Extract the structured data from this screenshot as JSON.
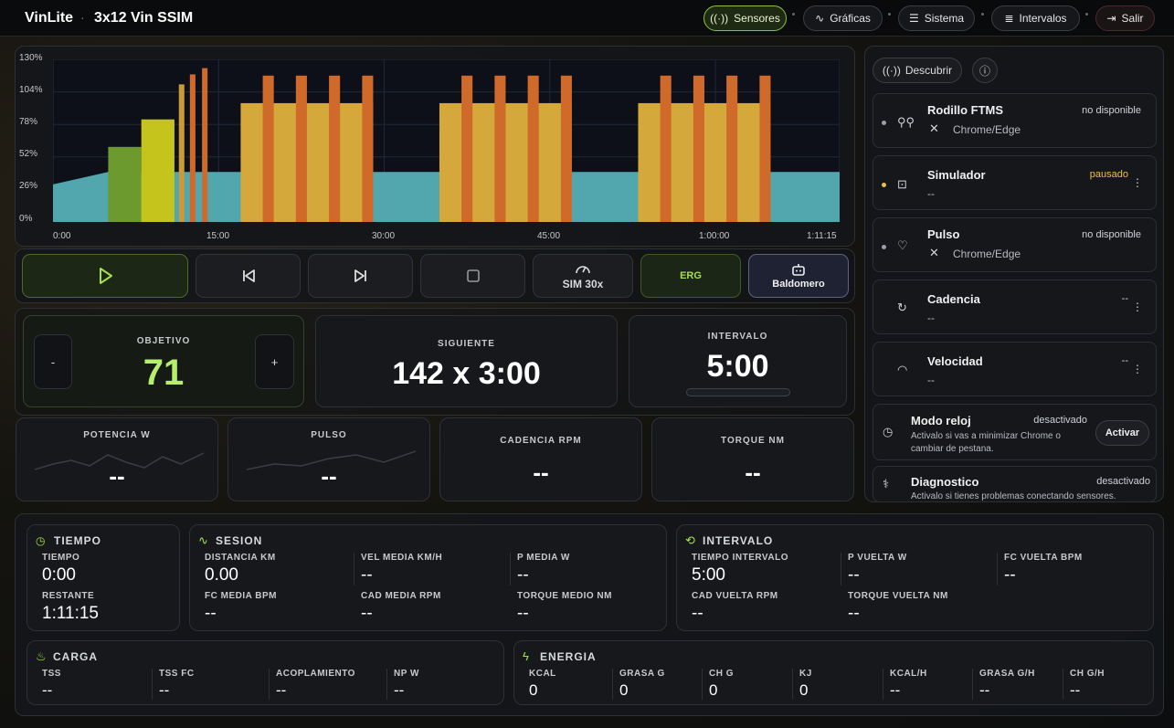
{
  "header": {
    "brand": "VinLite",
    "separator": "·",
    "workout_title": "3x12 Vin SSIM",
    "nav": [
      {
        "label": "Sensores",
        "icon": "broadcast-icon"
      },
      {
        "label": "Gráficas",
        "icon": "pulse-line-icon"
      },
      {
        "label": "Sistema",
        "icon": "sliders-icon"
      },
      {
        "label": "Intervalos",
        "icon": "list-icon"
      },
      {
        "label": "Salir",
        "icon": "logout-icon"
      }
    ]
  },
  "chart_data": {
    "type": "bar",
    "y_ticks": [
      "130%",
      "104%",
      "78%",
      "52%",
      "26%",
      "0%"
    ],
    "x_ticks": [
      "0:00",
      "15:00",
      "30:00",
      "45:00",
      "1:00:00",
      "1:11:15"
    ],
    "ylim": [
      0,
      130
    ],
    "x_range_min": [
      0,
      71.25
    ],
    "power_area": [
      [
        0,
        30
      ],
      [
        5,
        40
      ],
      [
        71.25,
        40
      ]
    ],
    "bars": [
      {
        "start": 5,
        "end": 8,
        "value": 60,
        "color": "#6d9a2e"
      },
      {
        "start": 8,
        "end": 11,
        "value": 82,
        "color": "#c5c41d"
      },
      {
        "start": 11.4,
        "end": 11.9,
        "value": 110,
        "color": "#c89a3a"
      },
      {
        "start": 12.4,
        "end": 12.9,
        "value": 118,
        "color": "#d06a2a"
      },
      {
        "start": 13.5,
        "end": 14.0,
        "value": 123,
        "color": "#d06a2a"
      },
      {
        "start": 17,
        "end": 29,
        "value": 95,
        "color": "#d4a83a"
      },
      {
        "start": 35,
        "end": 47,
        "value": 95,
        "color": "#d4a83a"
      },
      {
        "start": 53,
        "end": 65,
        "value": 95,
        "color": "#d4a83a"
      },
      {
        "start": 19,
        "end": 20,
        "value": 117,
        "color": "#d06a2a"
      },
      {
        "start": 22,
        "end": 23,
        "value": 117,
        "color": "#d06a2a"
      },
      {
        "start": 25,
        "end": 26,
        "value": 117,
        "color": "#d06a2a"
      },
      {
        "start": 28,
        "end": 29,
        "value": 117,
        "color": "#d06a2a"
      },
      {
        "start": 37,
        "end": 38,
        "value": 117,
        "color": "#d06a2a"
      },
      {
        "start": 40,
        "end": 41,
        "value": 117,
        "color": "#d06a2a"
      },
      {
        "start": 43,
        "end": 44,
        "value": 117,
        "color": "#d06a2a"
      },
      {
        "start": 46,
        "end": 47,
        "value": 117,
        "color": "#d06a2a"
      },
      {
        "start": 55,
        "end": 56,
        "value": 117,
        "color": "#d06a2a"
      },
      {
        "start": 58,
        "end": 59,
        "value": 117,
        "color": "#d06a2a"
      },
      {
        "start": 61,
        "end": 62,
        "value": 117,
        "color": "#d06a2a"
      },
      {
        "start": 64,
        "end": 65,
        "value": 117,
        "color": "#d06a2a"
      }
    ]
  },
  "controls": {
    "sim_label": "SIM 30x",
    "erg_label": "ERG",
    "profile_label": "Baldomero"
  },
  "target": {
    "label": "OBJETIVO",
    "value": "71",
    "minus": "-",
    "plus": "+"
  },
  "next": {
    "label": "SIGUIENTE",
    "value": "142 x 3:00"
  },
  "interval": {
    "label": "INTERVALO",
    "value": "5:00",
    "progress": 0
  },
  "metrics": [
    {
      "label": "POTENCIA W",
      "value": "--"
    },
    {
      "label": "PULSO",
      "value": "--"
    },
    {
      "label": "CADENCIA RPM",
      "value": "--"
    },
    {
      "label": "TORQUE NM",
      "value": "--"
    }
  ],
  "sensors_panel": {
    "discover_label": "Descubrir",
    "items": [
      {
        "name": "Rodillo FTMS",
        "sub": "Chrome/Edge",
        "status": "no disponible",
        "icon": "bike-icon"
      },
      {
        "name": "Simulador",
        "sub": "--",
        "status": "pausado",
        "icon": "robot-icon"
      },
      {
        "name": "Pulso",
        "sub": "Chrome/Edge",
        "status": "no disponible",
        "icon": "heart-pulse-icon"
      },
      {
        "name": "Cadencia",
        "sub": "--",
        "status": "--",
        "icon": "refresh-icon"
      },
      {
        "name": "Velocidad",
        "sub": "--",
        "status": "--",
        "icon": "gauge-icon"
      }
    ],
    "clock_mode": {
      "name": "Modo reloj",
      "status": "desactivado",
      "desc": "Activalo si vas a minimizar Chrome o cambiar de pestana.",
      "button": "Activar"
    },
    "diagnostic": {
      "name": "Diagnostico",
      "status": "desactivado",
      "desc": "Activalo si tienes problemas conectando sensores."
    }
  },
  "stats": {
    "tiempo": {
      "title": "TIEMPO",
      "tiempo_label": "TIEMPO",
      "tiempo_value": "0:00",
      "restante_label": "RESTANTE",
      "restante_value": "1:11:15"
    },
    "sesion": {
      "title": "SESION",
      "cells": [
        {
          "label": "DISTANCIA KM",
          "value": "0.00"
        },
        {
          "label": "VEL MEDIA KM/H",
          "value": "--"
        },
        {
          "label": "P MEDIA W",
          "value": "--"
        },
        {
          "label": "FC MEDIA BPM",
          "value": "--"
        },
        {
          "label": "CAD MEDIA RPM",
          "value": "--"
        },
        {
          "label": "TORQUE MEDIO NM",
          "value": "--"
        }
      ]
    },
    "intervalo": {
      "title": "INTERVALO",
      "cells": [
        {
          "label": "TIEMPO INTERVALO",
          "value": "5:00"
        },
        {
          "label": "P VUELTA W",
          "value": "--"
        },
        {
          "label": "FC VUELTA BPM",
          "value": "--"
        },
        {
          "label": "CAD VUELTA RPM",
          "value": "--"
        },
        {
          "label": "TORQUE VUELTA NM",
          "value": "--"
        }
      ]
    },
    "carga": {
      "title": "CARGA",
      "cells": [
        {
          "label": "TSS",
          "value": "--"
        },
        {
          "label": "TSS FC",
          "value": "--"
        },
        {
          "label": "ACOPLAMIENTO",
          "value": "--"
        },
        {
          "label": "NP W",
          "value": "--"
        }
      ]
    },
    "energia": {
      "title": "ENERGIA",
      "cells": [
        {
          "label": "KCAL",
          "value": "0"
        },
        {
          "label": "GRASA G",
          "value": "0"
        },
        {
          "label": "CH G",
          "value": "0"
        },
        {
          "label": "KJ",
          "value": "0"
        },
        {
          "label": "KCAL/H",
          "value": "--"
        },
        {
          "label": "GRASA G/H",
          "value": "--"
        },
        {
          "label": "CH G/H",
          "value": "--"
        }
      ]
    }
  }
}
